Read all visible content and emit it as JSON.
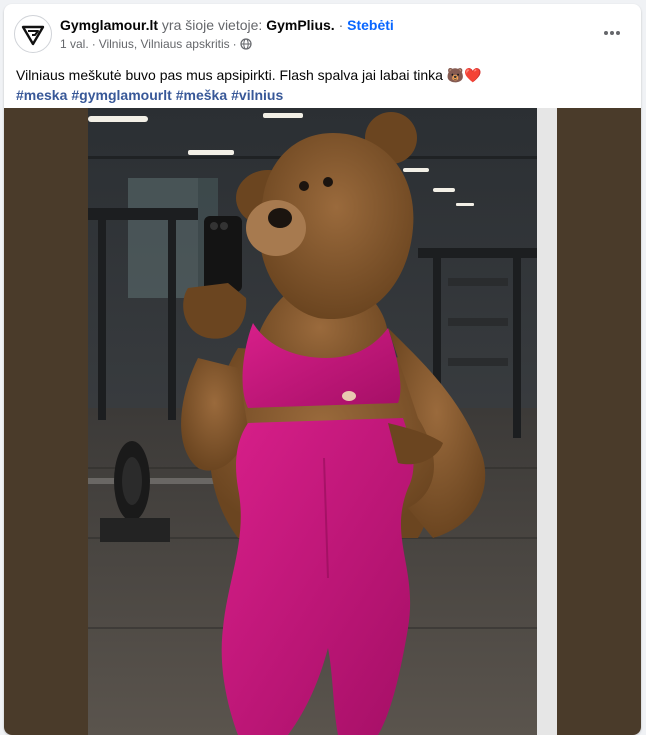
{
  "post": {
    "page_name": "Gymglamour.lt",
    "checkin_text": "yra šioje vietoje:",
    "place_name": "GymPlius.",
    "separator": "·",
    "follow_label": "Stebėti",
    "time": "1 val.",
    "location": "Vilnius, Vilniaus apskritis",
    "privacy_icon": "globe-icon",
    "more_icon": "more-options-icon",
    "caption": "Vilniaus meškutė buvo pas mus apsipirkti. Flash spalva jai labai tinka 🐻❤️",
    "hashtags": [
      "#meska",
      "#gymglamourlt",
      "#meška",
      "#vilnius"
    ]
  },
  "colors": {
    "link_blue": "#0866ff",
    "hashtag_blue": "#385898",
    "muted_text": "#65676b",
    "outfit_pink": "#c2187a"
  }
}
